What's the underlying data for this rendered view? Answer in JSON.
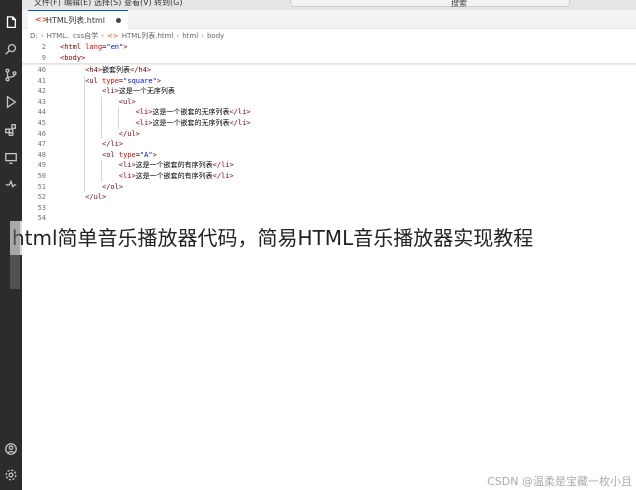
{
  "menubar": {
    "items": [
      "文件(F)",
      "编辑(E)",
      "选择(S)",
      "查看(V)",
      "转到(G)"
    ],
    "search_label": "搜索"
  },
  "tab": {
    "label": "HTML列表.html"
  },
  "breadcrumb": [
    "D:",
    "HTML、css自学",
    "HTML列表.html",
    "html",
    "body"
  ],
  "editor": {
    "sticky": [
      {
        "num": "2",
        "html": "<span class='t'>&lt;html</span> <span class='a'>lang</span><span class='x'>=</span><span class='v'>\"en\"</span><span class='t'>&gt;</span>"
      },
      {
        "num": "9",
        "html": "<span class='t'>&lt;body&gt;</span>"
      }
    ],
    "lines": [
      {
        "num": "40",
        "indent": 6,
        "html": "<span class='t'>&lt;h4&gt;</span>嵌套列表<span class='t'>&lt;/h4&gt;</span>"
      },
      {
        "num": "41",
        "indent": 6,
        "html": "<span class='t'>&lt;ul</span> <span class='a'>type</span>=<span class='v'>\"square\"</span><span class='t'>&gt;</span>"
      },
      {
        "num": "42",
        "indent": 10,
        "html": "<span class='t'>&lt;li&gt;</span>这是一个无序列表"
      },
      {
        "num": "43",
        "indent": 14,
        "html": "<span class='t'>&lt;ul&gt;</span>"
      },
      {
        "num": "44",
        "indent": 18,
        "html": "<span class='t'>&lt;li&gt;</span>这是一个嵌套的无序列表<span class='t'>&lt;/li&gt;</span>"
      },
      {
        "num": "45",
        "indent": 18,
        "html": "<span class='t'>&lt;li&gt;</span>这是一个嵌套的无序列表<span class='t'>&lt;/li&gt;</span>"
      },
      {
        "num": "46",
        "indent": 14,
        "html": "<span class='t'>&lt;/ul&gt;</span>"
      },
      {
        "num": "47",
        "indent": 10,
        "html": "<span class='t'>&lt;/li&gt;</span>"
      },
      {
        "num": "48",
        "indent": 10,
        "html": "<span class='t'>&lt;ol</span> <span class='a'>type</span>=<span class='v'>\"A\"</span><span class='t'>&gt;</span>"
      },
      {
        "num": "49",
        "indent": 14,
        "html": "<span class='t'>&lt;li&gt;</span>这是一个嵌套的有序列表<span class='t'>&lt;/li&gt;</span>"
      },
      {
        "num": "50",
        "indent": 14,
        "html": "<span class='t'>&lt;li&gt;</span>这是一个嵌套的有序列表<span class='t'>&lt;/li&gt;</span>"
      },
      {
        "num": "51",
        "indent": 10,
        "html": "<span class='t'>&lt;/ol&gt;</span>"
      },
      {
        "num": "52",
        "indent": 6,
        "html": "<span class='t'>&lt;/ul&gt;</span>"
      },
      {
        "num": "53",
        "indent": 0,
        "html": ""
      },
      {
        "num": "54",
        "indent": 0,
        "html": ""
      }
    ]
  },
  "overlay": {
    "title": "html简单音乐播放器代码，简易HTML音乐播放器实现教程"
  },
  "watermark": "CSDN @温柔是宝藏一枚小且"
}
